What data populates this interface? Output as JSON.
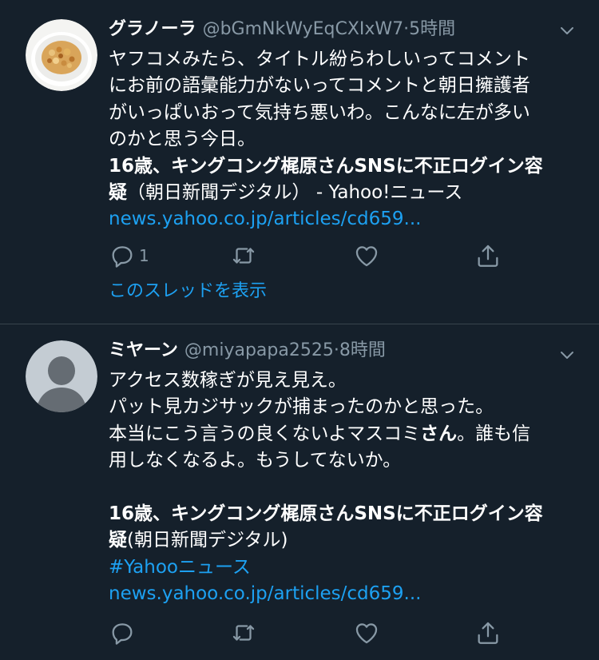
{
  "tweets": [
    {
      "name": "グラノーラ",
      "handle": "@bGmNkWyEqCXIxW7",
      "separator": "·",
      "time": "5時間",
      "lines": [
        "ヤフコメみたら、タイトル紛らわしいってコメント",
        "にお前の語彙能力がないってコメントと朝日擁護者",
        "がいっぱいおって気持ち悪いわ。こんなに左が多い",
        "のかと思う今日。"
      ],
      "headline_line1": "16歳、キングコング梶原さんSNSに不正ログイン容",
      "headline_bold2": "疑",
      "headline_rest2": "（朝日新聞デジタル） - Yahoo!ニュース",
      "link": "news.yahoo.co.jp/articles/cd659...",
      "reply_count": "1",
      "thread_link": "このスレッドを表示"
    },
    {
      "name": "ミヤーン",
      "handle": "@miyapapa2525",
      "separator": "·",
      "time": "8時間",
      "line1": "アクセス数稼ぎが見え見え。",
      "line2": "パット見カジサックが捕まったのかと思った。",
      "line3_a": "本当にこう言うの良くないよマスコミ",
      "line3_bold": "さん",
      "line3_b": "。誰も信",
      "line4": "用しなくなるよ。もうしてないか。",
      "headline_line1": "16歳、キングコング梶原さんSNSに不正ログイン容",
      "headline_bold2": "疑",
      "headline_rest2": "(朝日新聞デジタル)",
      "hashtag": "#Yahooニュース",
      "link": "news.yahoo.co.jp/articles/cd659..."
    }
  ],
  "icons": {
    "reply": "reply-icon",
    "retweet": "retweet-icon",
    "like": "like-icon",
    "share": "share-icon",
    "caret": "chevron-down-icon"
  },
  "colors": {
    "background": "#15202b",
    "text": "#ffffff",
    "secondary": "#8899a6",
    "link": "#1da1f2",
    "divider": "#38444d"
  }
}
